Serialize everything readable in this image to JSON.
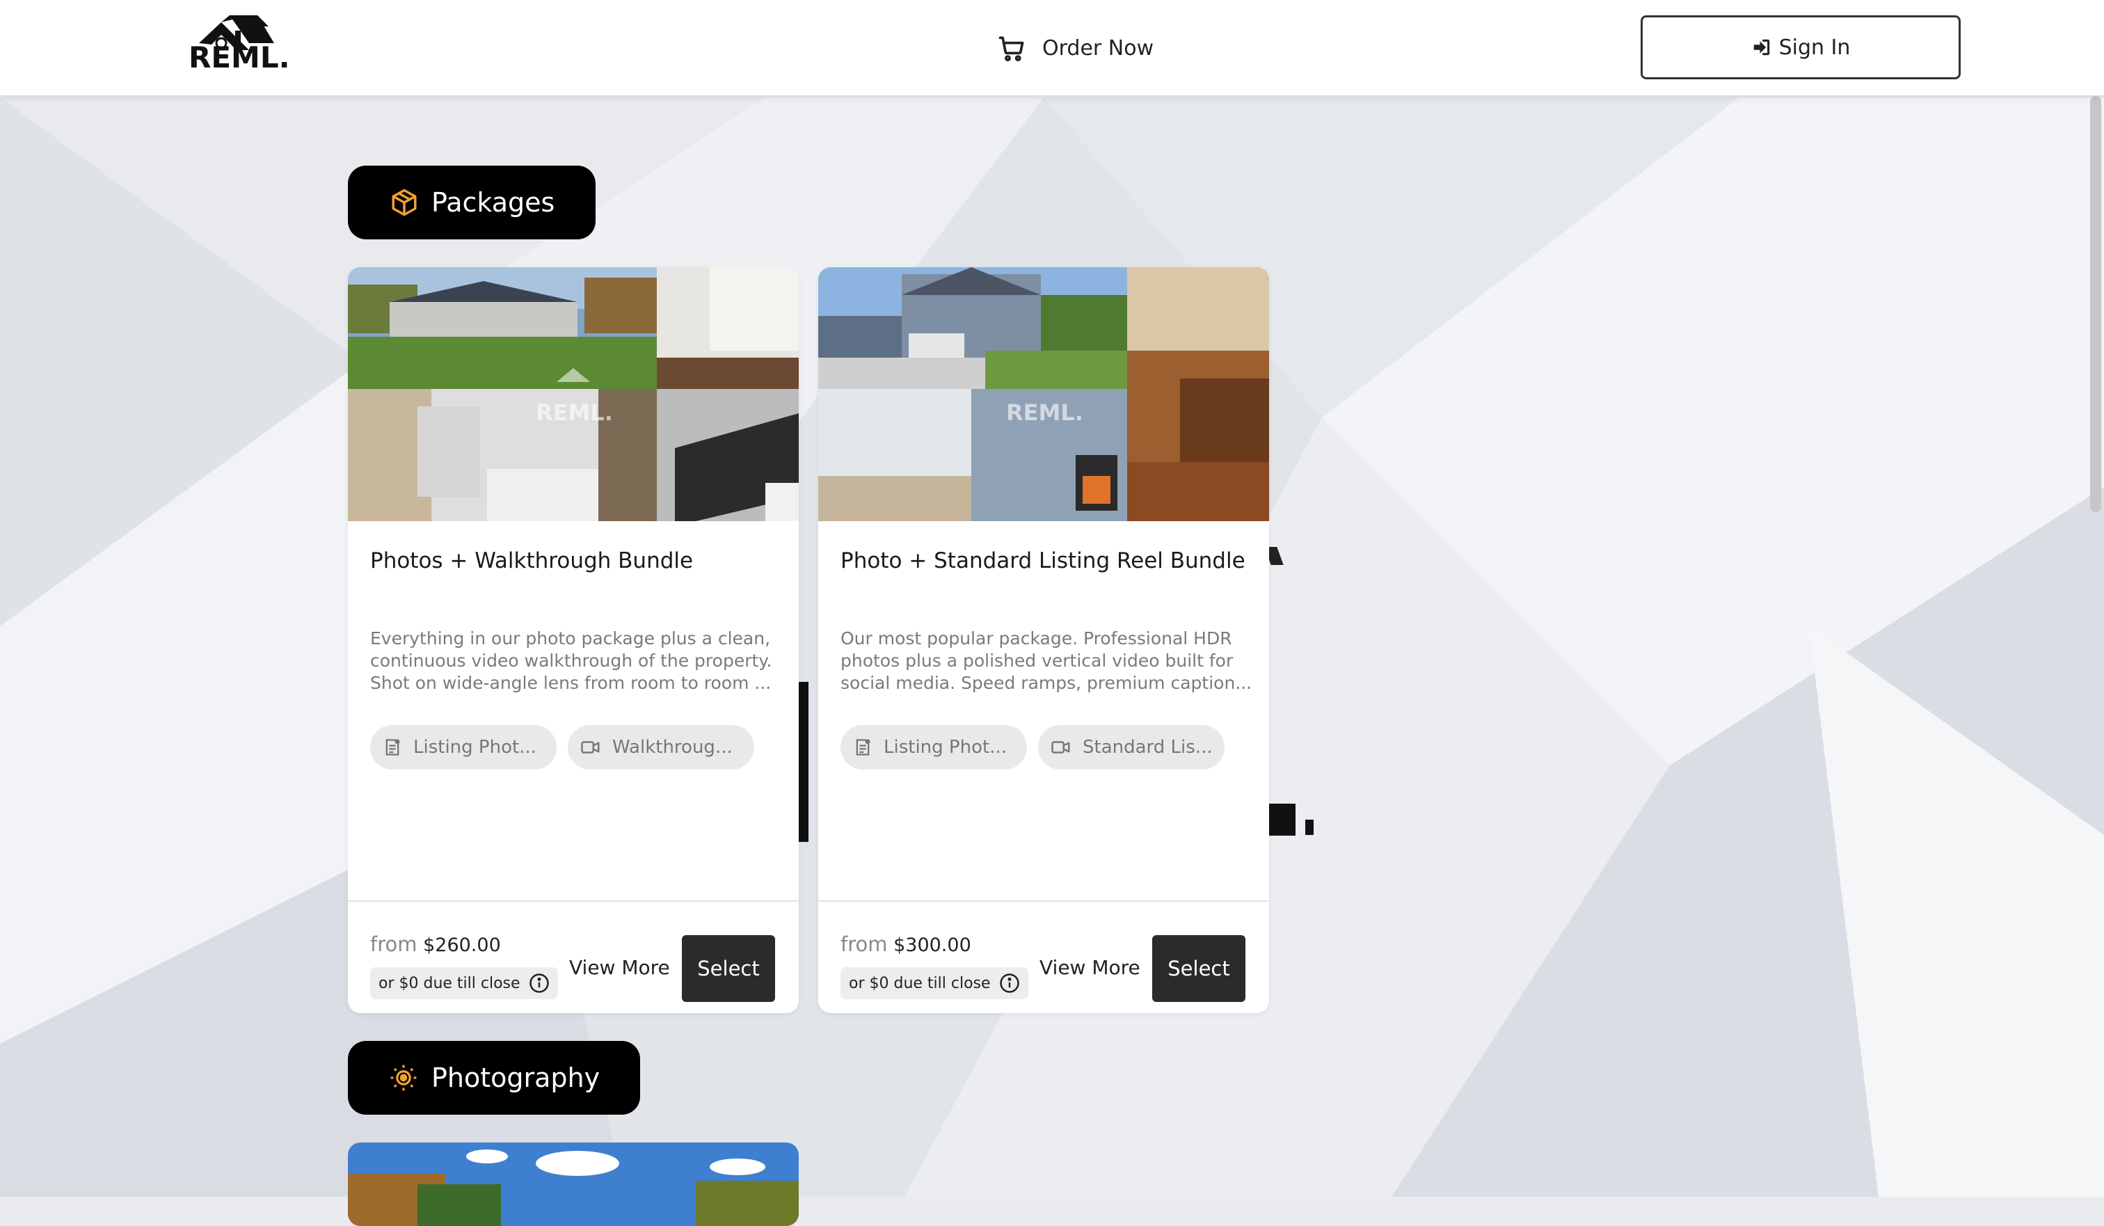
{
  "header": {
    "logo_text": "REML.",
    "order_now_label": "Order Now",
    "sign_in_label": "Sign In"
  },
  "sections": {
    "packages_label": "Packages",
    "photography_label": "Photography"
  },
  "cards": [
    {
      "title": "Photos + Walkthrough Bundle",
      "description_lines": [
        "Everything in our photo package plus a clean,",
        "continuous video walkthrough of the property.",
        "Shot on wide-angle lens from room to room ..."
      ],
      "chips": [
        {
          "label": "Listing Phot...",
          "icon": "photo-doc-icon"
        },
        {
          "label": "Walkthroug...",
          "icon": "video-camera-icon"
        }
      ],
      "from_label": "from",
      "price": "$260.00",
      "due_label": "or $0 due till close",
      "view_more_label": "View More",
      "select_label": "Select",
      "watermark": "REML."
    },
    {
      "title": "Photo + Standard Listing Reel Bundle",
      "description_lines": [
        "Our most popular package. Professional HDR",
        "photos plus a polished vertical video built for",
        "social media. Speed ramps, premium caption..."
      ],
      "chips": [
        {
          "label": "Listing Phot...",
          "icon": "photo-doc-icon"
        },
        {
          "label": "Standard Lis...",
          "icon": "video-camera-icon"
        }
      ],
      "from_label": "from",
      "price": "$300.00",
      "due_label": "or $0 due till close",
      "view_more_label": "View More",
      "select_label": "Select",
      "watermark": "REML."
    }
  ],
  "colors": {
    "accent_orange": "#f0a030",
    "pill_bg": "#000000",
    "select_bg": "#2b2b2b"
  }
}
